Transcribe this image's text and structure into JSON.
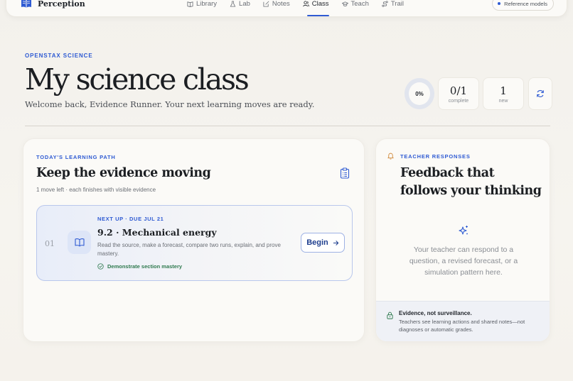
{
  "app": {
    "name": "Perception"
  },
  "nav": {
    "items": [
      {
        "label": "Library",
        "icon": "book-icon"
      },
      {
        "label": "Lab",
        "icon": "flask-icon"
      },
      {
        "label": "Notes",
        "icon": "edit-icon"
      },
      {
        "label": "Class",
        "icon": "users-icon",
        "active": true
      },
      {
        "label": "Teach",
        "icon": "graduation-cap-icon"
      },
      {
        "label": "Trail",
        "icon": "route-icon"
      }
    ],
    "reference_pill": "Reference models"
  },
  "hero": {
    "eyebrow": "OPENSTAX SCIENCE",
    "title": "My science class",
    "subtitle": "Welcome back, Evidence Runner. Your next learning moves are ready."
  },
  "stats": {
    "progress_label": "0%",
    "progress_value": 0,
    "complete": {
      "value": "0/1",
      "label": "complete"
    },
    "new": {
      "value": "1",
      "label": "new"
    }
  },
  "learning_path": {
    "eyebrow": "TODAY'S LEARNING PATH",
    "title": "Keep the evidence moving",
    "meta": "1 move left · each finishes with visible evidence",
    "move": {
      "number": "01",
      "eyebrow": "NEXT UP · DUE JUL 21",
      "title": "9.2 · Mechanical energy",
      "description": "Read the source, make a forecast, compare two runs, explain, and prove mastery.",
      "goal": "Demonstrate section mastery",
      "action_label": "Begin"
    }
  },
  "teacher_responses": {
    "eyebrow": "TEACHER RESPONSES",
    "title": "Feedback that follows your thinking",
    "empty_text": "Your teacher can respond to a question, a revised forecast, or a simulation pattern here.",
    "footer_title": "Evidence, not surveillance.",
    "footer_text": "Teachers see learning actions and shared notes—not diagnoses or automatic grades."
  },
  "colors": {
    "accent": "#2f5bd3",
    "success": "#2f7a4f",
    "background": "#f3f1ec"
  }
}
